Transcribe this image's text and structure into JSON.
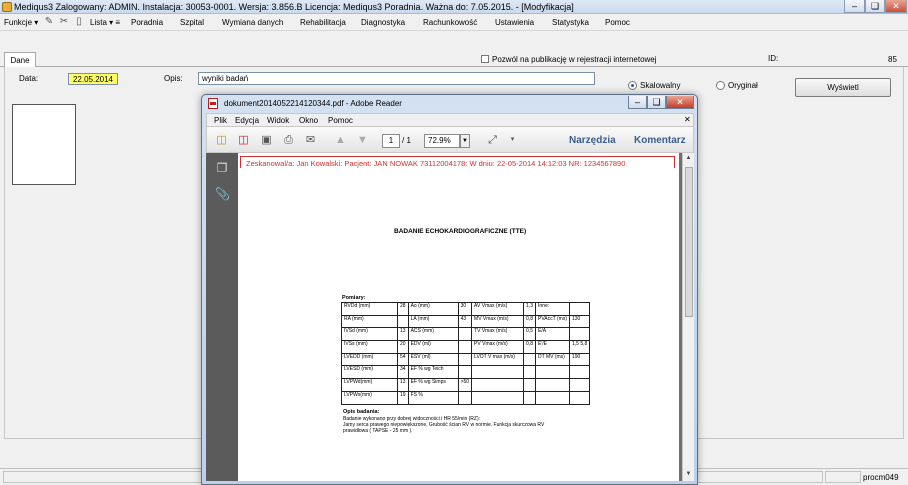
{
  "window": {
    "title": "Mediqus3 Zalogowany: ADMIN. Instalacja: 30053-0001. Wersja: 3.856.B Licencja: Mediqus3 Poradnia. Ważna do: 7.05.2015. - [Modyfikacja]"
  },
  "menu": {
    "funkcje": "Funkcje",
    "lista": "Lista",
    "poradnia": "Poradnia",
    "szpital": "Szpital",
    "wymiana": "Wymiana danych",
    "rehabilitacja": "Rehabilitacja",
    "diagnostyka": "Diagnostyka",
    "rachunkowosc": "Rachunkowość",
    "ustawienia": "Ustawienia",
    "statystyka": "Statystyka",
    "pomoc": "Pomoc"
  },
  "tabs": {
    "dane": "Dane"
  },
  "form": {
    "publikacja_label": "Pozwól na publikację w rejestracji internetowej",
    "publikacja_checked": false,
    "id_label": "ID:",
    "id_value": "85",
    "data_label": "Data:",
    "data_value": "22.05.2014",
    "opis_label": "Opis:",
    "opis_value": "wyniki badań",
    "skalowalny_label": "Skalowalny",
    "skalowalny_selected": true,
    "oryginal_label": "Oryginał",
    "oryginal_selected": false,
    "wyswietl_label": "Wyświetl"
  },
  "status": {
    "user": "procm049"
  },
  "reader": {
    "title": "dokument2014052214120344.pdf - Adobe Reader",
    "menu": {
      "plik": "Plik",
      "edycja": "Edycja",
      "widok": "Widok",
      "okno": "Okno",
      "pomoc": "Pomoc"
    },
    "page_current": "1",
    "page_total": "/ 1",
    "zoom": "72.9%",
    "narzedzia": "Narzędzia",
    "komentarz": "Komentarz",
    "scan_header": "Zeskanowal/a: Jan Kowalski: Pacjent: JAN NOWAK 73112004178: W dniu: 22-05-2014 14:12:03 NR: 1234567890",
    "doc": {
      "title": "BADANIE ECHOKARDIOGRAFICZNE (TTE)",
      "pomiary_label": "Pomiary:",
      "table": [
        [
          "RVDd (mm)",
          "28",
          "Ao (mm)",
          "30",
          "AV Vmax (m/s)",
          "1,3",
          "Inne:",
          ""
        ],
        [
          "RA (mm)",
          "",
          "LA (mm)",
          "43",
          "MV Vmax (m/s)",
          "0,8",
          "PVAccT (ms)",
          "130"
        ],
        [
          "IVSd (mm)",
          "13",
          "ACS (mm)",
          "",
          "TV Vmax (m/s)",
          "0,5",
          "E/A",
          ""
        ],
        [
          "IVSs (mm)",
          "20",
          "EDV (ml)",
          "",
          "PV Vmax (m/s)",
          "0,8",
          "E'/E",
          "1,5 5,8"
        ],
        [
          "LVEDD (mm)",
          "54",
          "ESV (ml)",
          "",
          "LVOT V max (m/s)",
          "",
          "DT MV (ms)",
          "190"
        ],
        [
          "LVESD (mm)",
          "34",
          "EF % wg Teich",
          "",
          "",
          "",
          "",
          ""
        ],
        [
          "LVPWd(mm)",
          "13",
          "EF % wg Simps",
          ">50",
          "",
          "",
          "",
          ""
        ],
        [
          "LVPWs(mm)",
          "19",
          "FS %",
          "",
          "",
          "",
          "",
          ""
        ]
      ],
      "opis_label": "Opis badania:",
      "opis_lines": [
        "Badanie wykonano przy dobrej widoczności i HR 55/min (RZ):",
        "Jamy serca prawego niepowiększone. Grubość ścian RV w normie. Funkcja skurczowa RV",
        "prawidłowa ( TAPSE - 25 mm )."
      ]
    }
  }
}
